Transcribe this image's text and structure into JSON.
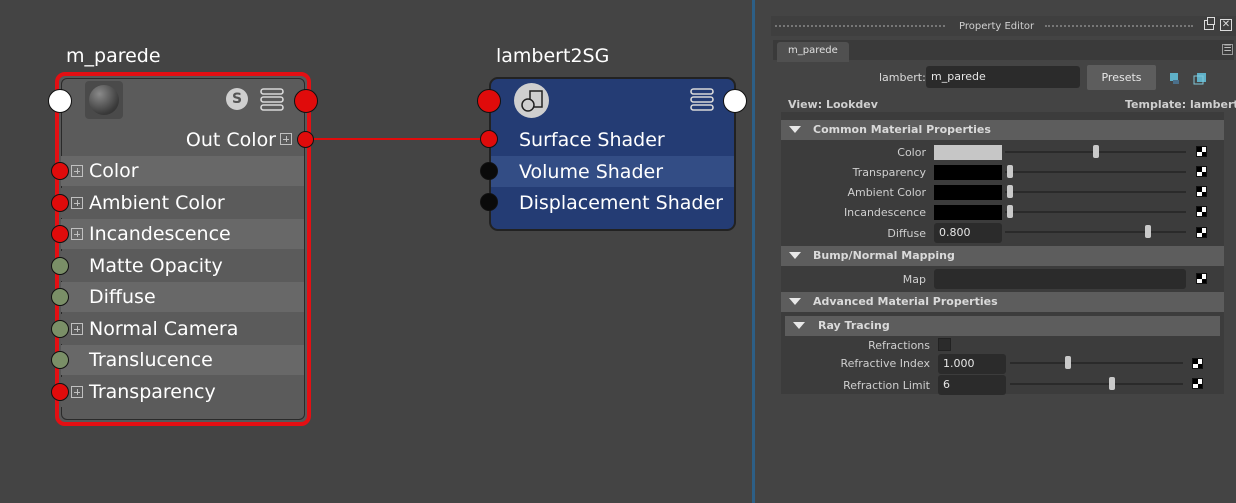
{
  "graph": {
    "material_node": {
      "title": "m_parede",
      "swatch_badge": "S",
      "out_label": "Out Color",
      "attributes": [
        {
          "label": "Color"
        },
        {
          "label": "Ambient Color"
        },
        {
          "label": "Incandescence"
        },
        {
          "label": "Matte Opacity"
        },
        {
          "label": "Diffuse"
        },
        {
          "label": "Normal Camera"
        },
        {
          "label": "Translucence"
        },
        {
          "label": "Transparency"
        }
      ]
    },
    "sg_node": {
      "title": "lambert2SG",
      "attributes": [
        {
          "label": "Surface Shader"
        },
        {
          "label": "Volume Shader"
        },
        {
          "label": "Displacement Shader"
        }
      ]
    },
    "colors": {
      "selected_border": "#e40f13",
      "connected_port": "#e00b0b",
      "unconnected_port": "#7a8f67",
      "sg_body": "#243c74"
    }
  },
  "property_editor": {
    "title": "Property Editor",
    "tab": "m_parede",
    "node_type_label": "lambert:",
    "node_name": "m_parede",
    "presets_label": "Presets",
    "view_label": "View: Lookdev",
    "template_label": "Template: lambert",
    "common": {
      "title": "Common Material Properties",
      "color_label": "Color",
      "transparency_label": "Transparency",
      "ambient_label": "Ambient Color",
      "incandescence_label": "Incandescence",
      "diffuse_label": "Diffuse",
      "diffuse_value": "0.800"
    },
    "bump": {
      "title": "Bump/Normal Mapping",
      "map_label": "Map"
    },
    "advanced": {
      "title": "Advanced Material Properties",
      "raytracing": {
        "title": "Ray Tracing",
        "refractions_label": "Refractions",
        "refractive_index_label": "Refractive Index",
        "refractive_index_value": "1.000",
        "refraction_limit_label": "Refraction Limit",
        "refraction_limit_value": "6"
      }
    }
  }
}
